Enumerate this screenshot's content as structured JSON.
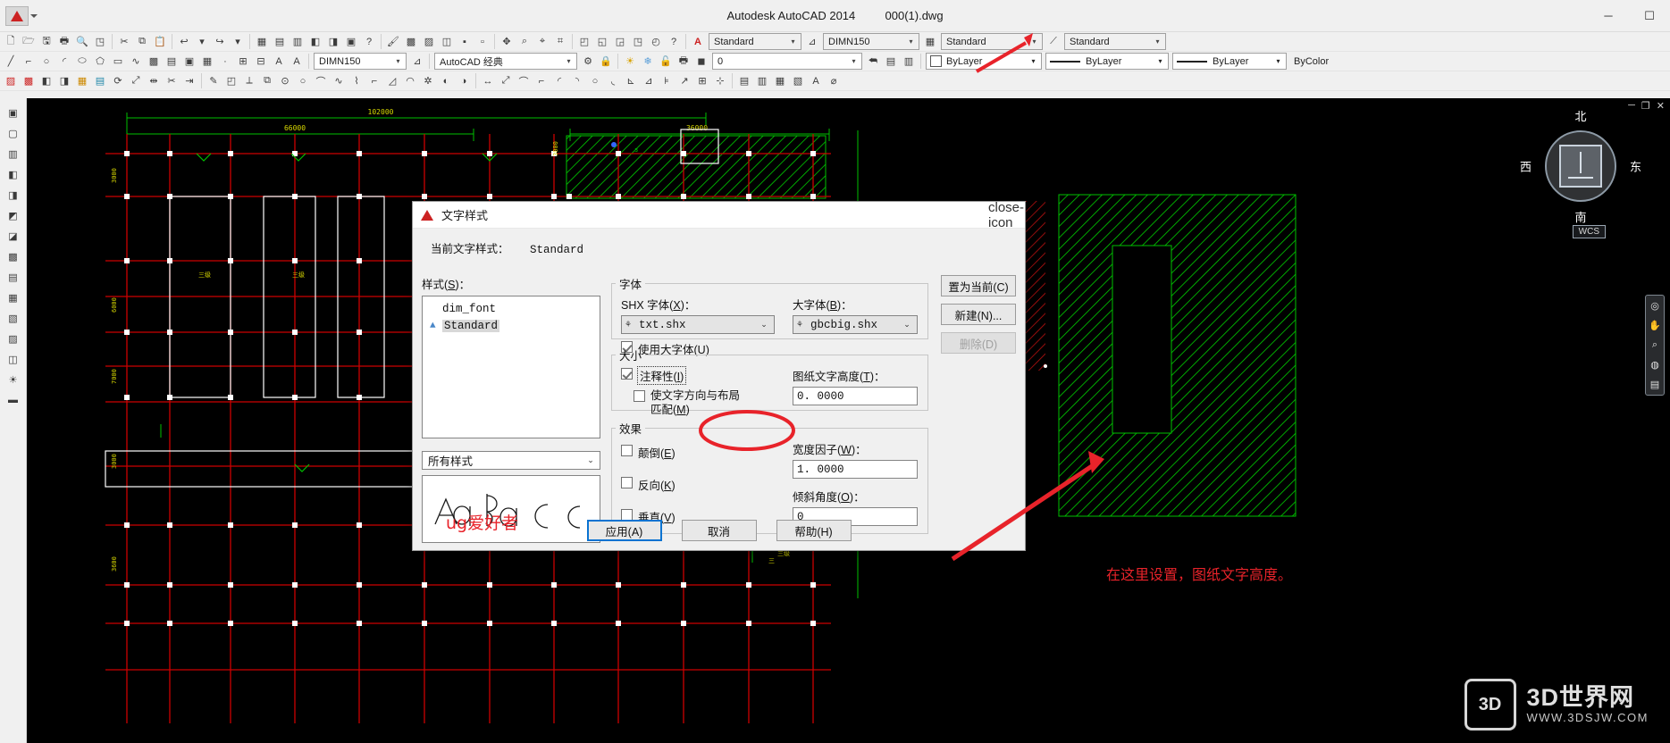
{
  "window": {
    "title": "Autodesk AutoCAD 2014",
    "file": "000(1).dwg",
    "minimize": "─",
    "maximize": "☐",
    "logo_icon": "autocad-logo"
  },
  "quick_access": {
    "caret": "▾"
  },
  "toolbar_row1": {
    "icons": [
      "new-file-icon",
      "open-folder-icon",
      "save-icon",
      "print-icon",
      "plot-preview-icon",
      "publish-icon",
      "web-icon",
      "undo-icon",
      "redo-icon",
      "arrow-down-icon",
      "cut-icon",
      "copy-icon",
      "paste-icon",
      "match-properties-icon",
      "properties-icon",
      "help-icon"
    ],
    "group2": [
      "layer-properties-icon",
      "layer-state-icon",
      "layer-previous-icon",
      "layer-off-icon",
      "layer-freeze-icon",
      "layer-lock-icon",
      "layer-isolate-icon",
      "layer-icon"
    ],
    "group3": [
      "pan-icon",
      "zoom-window-icon",
      "zoom-previous-icon",
      "zoom-realtime-icon"
    ],
    "group4": [
      "block-icon",
      "block-edit-icon",
      "design-center-icon",
      "tool-palette-icon",
      "sheet-set-icon",
      "help2-icon"
    ],
    "text_style_icon": "text-style-icon",
    "text_style": "Standard",
    "dim_style_icon": "dim-style-icon",
    "dim_style": "DIMN150",
    "table_style_icon": "table-style-icon",
    "table_style": "Standard",
    "mleader_style_icon": "mleader-style-icon",
    "mleader_style": "Standard"
  },
  "toolbar_row2": {
    "draw_icons": [
      "line-icon",
      "polyline-icon",
      "circle-icon",
      "arc-icon",
      "ellipse-icon",
      "polygon-icon",
      "rectangle-icon",
      "spline-icon",
      "hatch-icon",
      "gradient-icon",
      "region-icon",
      "table-icon",
      "multiline-text-icon",
      "text-icon",
      "insert-block-icon",
      "make-block-icon",
      "point-icon"
    ],
    "dim_style": "DIMN150",
    "dim_scale_icon": "dimension-style-icon",
    "workspace": "AutoCAD 经典",
    "workspace_settings_icon": "workspace-settings-icon",
    "workspace_lock_icon": "workspace-lock-icon",
    "layer_icons": [
      "layer-onoff-icon",
      "layer-freeze-icon",
      "layer-lock-icon",
      "layer-plot-icon",
      "layer-color-icon"
    ],
    "layer_name": "0",
    "layer_tools": [
      "layer-previous-icon",
      "layer-states-icon",
      "layer-match-icon"
    ],
    "color_swatch": "#ffffff",
    "color": "ByLayer",
    "linetype": "ByLayer",
    "lineweight": "ByLayer",
    "plotstyle": "ByColor"
  },
  "toolbar_row3": {
    "modify_icons": [
      "erase-icon",
      "copy-object-icon",
      "mirror-icon",
      "offset-icon",
      "array-icon",
      "move-icon",
      "rotate-icon",
      "scale-icon",
      "stretch-icon",
      "trim-icon",
      "extend-icon",
      "break-icon",
      "chamfer-icon",
      "fillet-icon",
      "explode-icon"
    ],
    "draw_order_icons": [
      "draw-order-icon",
      "bring-front-icon",
      "send-back-icon",
      "measure-icon",
      "divide-icon",
      "boundary-icon",
      "join-icon",
      "blend-icon",
      "revcloud-icon",
      "wipeout-icon",
      "3dorbit-icon",
      "render-icon"
    ],
    "dim_icons": [
      "linear-dim-icon",
      "aligned-dim-icon",
      "arclength-dim-icon",
      "ordinate-dim-icon",
      "radius-dim-icon",
      "jog-dim-icon",
      "diameter-dim-icon",
      "angular-dim-icon",
      "quick-dim-icon",
      "baseline-dim-icon",
      "continue-dim-icon",
      "leader-icon",
      "tolerance-icon",
      "center-mark-icon",
      "dim-edit-icon",
      "dim-text-edit-icon",
      "dim-update-icon",
      "dim-style-ctrl-icon",
      "text-style-A-icon",
      "dim-style-dropdown-icon"
    ]
  },
  "left_dock": {
    "icons": [
      "workspace-icon",
      "modeling-icon",
      "mesh-icon",
      "solid-edit-icon",
      "surface-icon",
      "section-icon",
      "visual-style-icon",
      "render-icon",
      "camera-icon",
      "walk-icon",
      "animation-icon",
      "materials-icon",
      "lights-icon",
      "sun-icon",
      "mapping-icon"
    ]
  },
  "canvas": {
    "document_controls": [
      "minimize-doc-icon",
      "restore-doc-icon",
      "close-doc-icon"
    ],
    "viewcube": {
      "north": "北",
      "south": "南",
      "west": "西",
      "east": "东"
    },
    "wcs_label": "WCS",
    "nav_bar_icons": [
      "pan-hand-icon",
      "zoom-icon",
      "orbit-icon",
      "steering-wheel-icon",
      "showmotion-icon"
    ],
    "dimension_labels": [
      "102000",
      "66000",
      "36000",
      "3000",
      "3000",
      "6000",
      "7000",
      "3000",
      "3600"
    ],
    "grid_text_labels": [
      "三级",
      "三级",
      "三级"
    ]
  },
  "dialog": {
    "title": "文字样式",
    "icon": "autocad-dialog-icon",
    "close_icon": "close-icon",
    "current_style_label": "当前文字样式：",
    "current_style_value": "Standard",
    "styles_label": "样式(S)：",
    "styles_label_mnemonic": "S",
    "style_list": [
      {
        "name": "dim_font",
        "annotative": false,
        "selected": false
      },
      {
        "name": "Standard",
        "annotative": true,
        "selected": true
      }
    ],
    "filter_value": "所有样式",
    "preview_text": "AaBbCc",
    "preview_overlay": "ug爱好者",
    "font_group": {
      "legend": "字体",
      "shx_label": "SHX 字体(X)：",
      "shx_value": "txt.shx",
      "bigfont_label": "大字体(B)：",
      "bigfont_value": "gbcbig.shx",
      "use_bigfont_label": "使用大字体(U)",
      "use_bigfont_checked": true
    },
    "size_group": {
      "legend": "大小",
      "annotative_label": "注释性(I)",
      "annotative_checked": true,
      "match_layout_label": "使文字方向与布局",
      "match_layout_label2": "匹配(M)",
      "match_layout_checked": false,
      "height_label": "图纸文字高度(T)：",
      "height_value": "0. 0000"
    },
    "effects_group": {
      "legend": "效果",
      "upside_down_label": "颠倒(E)",
      "upside_down_checked": false,
      "backwards_label": "反向(K)",
      "backwards_checked": false,
      "vertical_label": "垂直(V)",
      "vertical_checked": false,
      "width_factor_label": "宽度因子(W)：",
      "width_factor_value": "1. 0000",
      "oblique_label": "倾斜角度(O)：",
      "oblique_value": "0"
    },
    "side_buttons": [
      {
        "label": "置为当前(C)",
        "disabled": false
      },
      {
        "label": "新建(N)...",
        "disabled": false
      },
      {
        "label": "删除(D)",
        "disabled": true
      }
    ],
    "bottom_buttons": [
      {
        "label": "应用(A)",
        "default": true
      },
      {
        "label": "取消",
        "default": false
      },
      {
        "label": "帮助(H)",
        "default": false
      }
    ]
  },
  "annotations": {
    "note_text": "在这里设置，图纸文字高度。",
    "accent_color": "#e8232a"
  },
  "watermark": {
    "logo": "3D",
    "name": "3D世界网",
    "url": "WWW.3DSJW.COM"
  }
}
